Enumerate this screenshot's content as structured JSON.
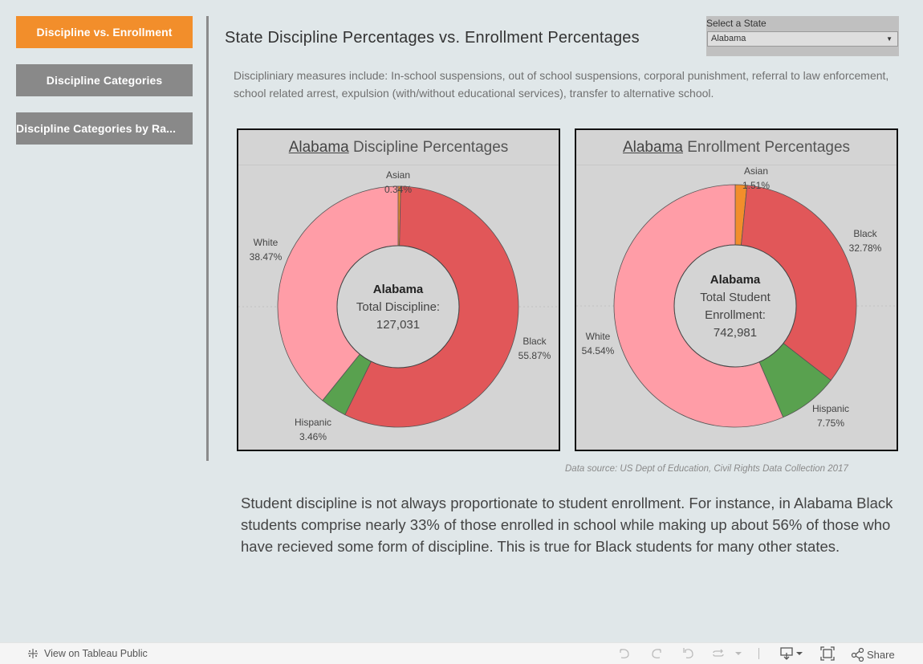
{
  "nav": {
    "items": [
      {
        "label": "Discipline vs. Enrollment",
        "active": true
      },
      {
        "label": "Discipline Categories",
        "active": false
      },
      {
        "label": "Discipline Categories by Ra...",
        "active": false
      }
    ]
  },
  "header": {
    "title": "State Discipline Percentages vs. Enrollment Percentages"
  },
  "filter": {
    "label": "Select a State",
    "selected": "Alabama"
  },
  "description": "Discipliniary measures include: In-school suspensions, out of school suspensions, corporal punishment, referral to law enforcement, school related arrest, expulsion (with/without educational services), transfer to alternative school.",
  "colors": {
    "Asian": "#f28e2b",
    "Black": "#e15759",
    "Hispanic": "#59a14f",
    "White": "#ff9da7",
    "active_nav": "#f28e2b",
    "inactive_nav": "#898989"
  },
  "chart_data": [
    {
      "type": "pie",
      "title_state": "Alabama",
      "title_rest": "Discipline Percentages",
      "center": {
        "title": "Alabama",
        "lines": [
          "Total Discipline:",
          "127,031"
        ]
      },
      "categories": [
        "Asian",
        "Black",
        "Hispanic",
        "White"
      ],
      "values": [
        0.34,
        55.87,
        3.46,
        38.47
      ],
      "value_labels": [
        "0.34%",
        "55.87%",
        "3.46%",
        "38.47%"
      ],
      "unit": "%"
    },
    {
      "type": "pie",
      "title_state": "Alabama",
      "title_rest": "Enrollment Percentages",
      "center": {
        "title": "Alabama",
        "lines": [
          "Total Student",
          "Enrollment:",
          "742,981"
        ]
      },
      "categories": [
        "Asian",
        "Black",
        "Hispanic",
        "White"
      ],
      "values": [
        1.51,
        32.78,
        7.75,
        54.54
      ],
      "value_labels": [
        "1.51%",
        "32.78%",
        "7.75%",
        "54.54%"
      ],
      "unit": "%"
    }
  ],
  "source": "Data source: US Dept of Education, Civil Rights Data Collection 2017",
  "summary": "Student discipline is not always proportionate to student enrollment. For instance, in Alabama Black students comprise nearly 33% of those enrolled in school while making up about 56% of those who have recieved some form of discipline. This is true for Black students for many other states.",
  "footer": {
    "tableau_link": "View on Tableau Public",
    "share_label": "Share",
    "icons": [
      "undo-icon",
      "redo-icon",
      "revert-icon",
      "refresh-icon",
      "dropdown-icon",
      "download-icon",
      "fullscreen-icon",
      "share-icon"
    ]
  }
}
